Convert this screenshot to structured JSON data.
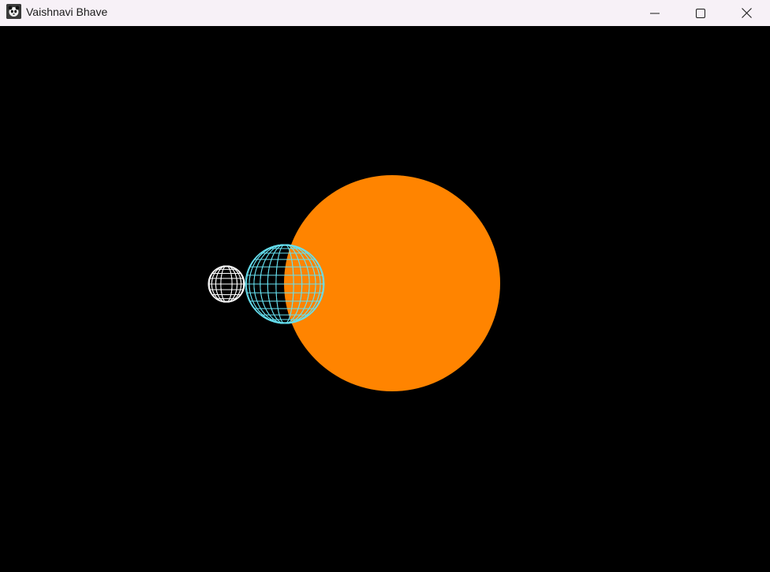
{
  "window": {
    "title": "Vaishnavi Bhave",
    "app_icon": "panda-icon",
    "controls": {
      "minimize_icon": "minimize-icon",
      "maximize_icon": "maximize-icon",
      "close_icon": "close-icon"
    }
  },
  "scene": {
    "background_color": "#000000",
    "sun": {
      "color": "#ff8400",
      "style": "solid"
    },
    "earth": {
      "color": "#66e0f0",
      "style": "wireframe"
    },
    "moon": {
      "color": "#ffffff",
      "style": "wireframe"
    }
  }
}
